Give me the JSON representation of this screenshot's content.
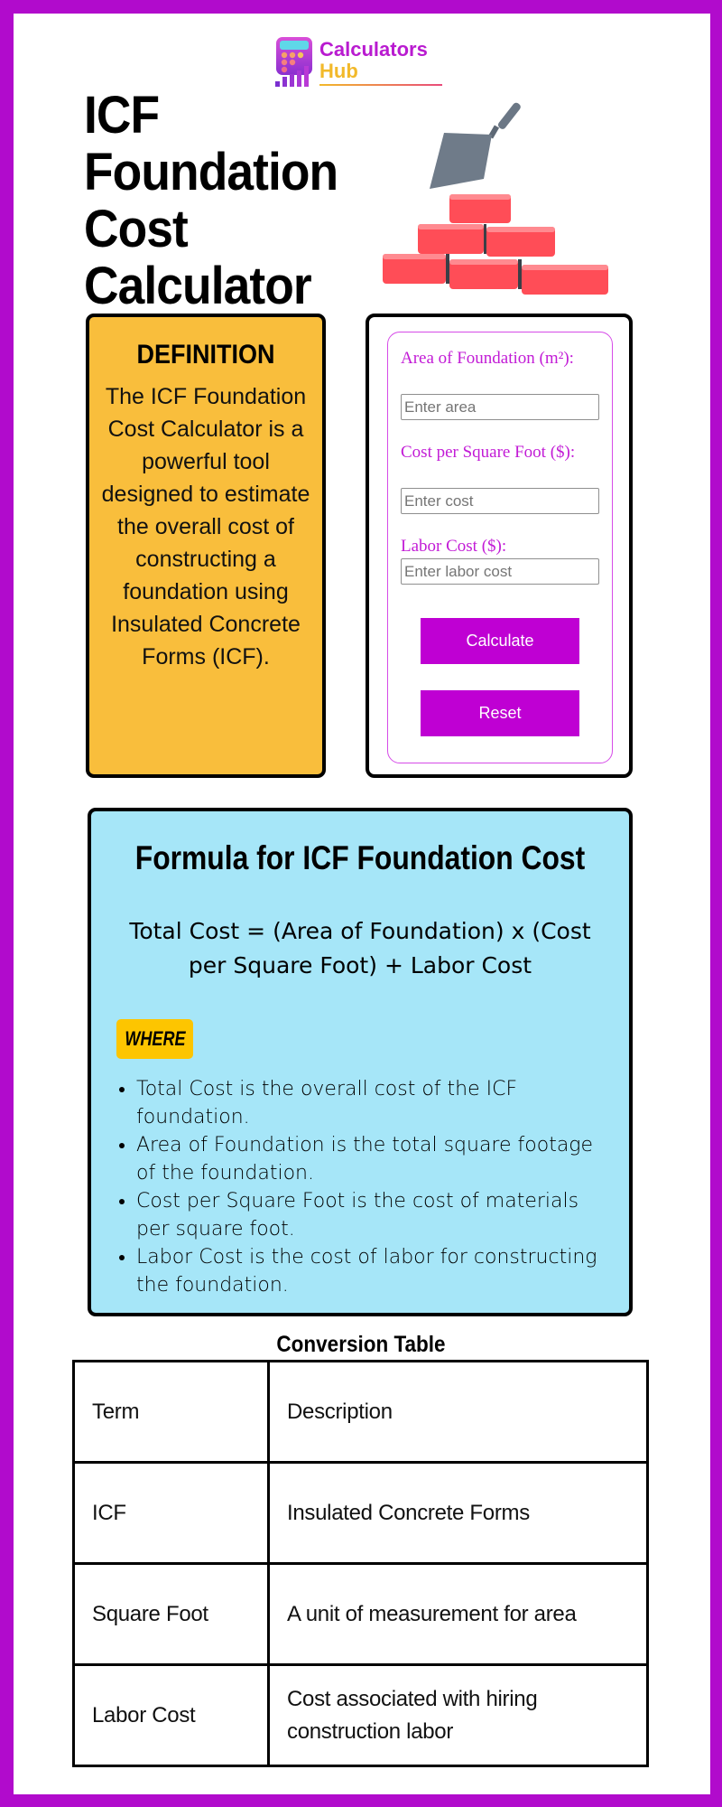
{
  "brand": {
    "name_line1": "Calculators",
    "name_line2": "Hub",
    "primary_color": "#b10bcc",
    "accent_color": "#f2b92a"
  },
  "page": {
    "title": "ICF Foundation Cost Calculator",
    "hero_image": "brick-wall-trowel-illustration"
  },
  "definition": {
    "heading": "DEFINITION",
    "body": "The ICF Foundation Cost Calculator is a powerful tool designed to estimate the overall cost of constructing a foundation using Insulated Concrete Forms (ICF).",
    "background_color": "#f9be3c"
  },
  "calculator": {
    "fields": [
      {
        "label": "Area of Foundation (m²):",
        "placeholder": "Enter area",
        "value": ""
      },
      {
        "label": "Cost per Square Foot ($):",
        "placeholder": "Enter cost",
        "value": ""
      },
      {
        "label": "Labor Cost ($):",
        "placeholder": "Enter labor cost",
        "value": ""
      }
    ],
    "calculate_label": "Calculate",
    "reset_label": "Reset",
    "button_color": "#bf00d3"
  },
  "formula": {
    "heading": "Formula for ICF Foundation Cost",
    "equation": "Total Cost = (Area of Foundation) x (Cost per Square Foot) + Labor Cost",
    "where_label": "WHERE",
    "items": [
      "Total Cost is the overall cost of the ICF foundation.",
      "Area of Foundation is the total square footage of the foundation.",
      "Cost per Square Foot is the cost of materials per square foot.",
      "Labor Cost is the cost of labor for constructing the foundation."
    ],
    "background_color": "#a6e6f8"
  },
  "table": {
    "title": "Conversion Table",
    "rows": [
      [
        "Term",
        "Description"
      ],
      [
        "ICF",
        "Insulated Concrete Forms"
      ],
      [
        "Square Foot",
        "A unit of measurement for area"
      ],
      [
        "Labor Cost",
        "Cost associated with hiring construction labor"
      ]
    ]
  }
}
